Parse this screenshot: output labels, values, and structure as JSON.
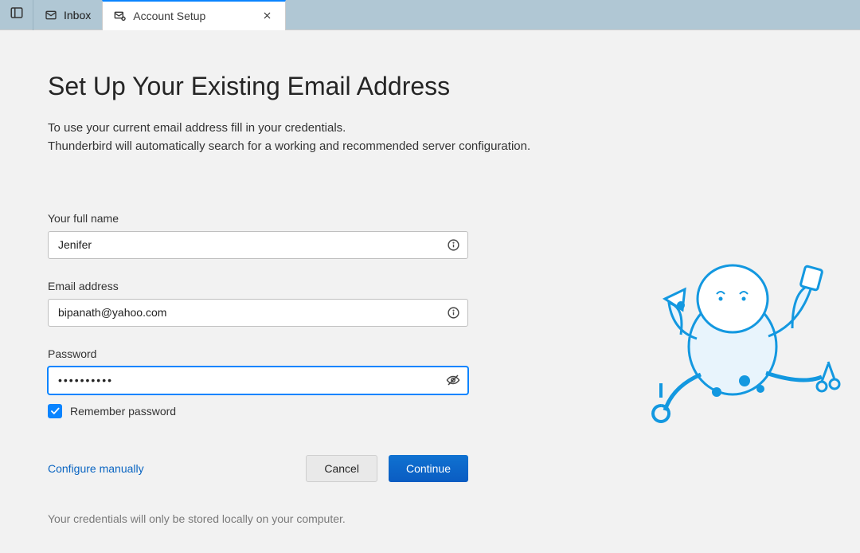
{
  "tabs": {
    "inbox_label": "Inbox",
    "account_setup_label": "Account Setup"
  },
  "page": {
    "title": "Set Up Your Existing Email Address",
    "subtitle_line1": "To use your current email address fill in your credentials.",
    "subtitle_line2": "Thunderbird will automatically search for a working and recommended server configuration."
  },
  "form": {
    "name_label": "Your full name",
    "name_value": "Jenifer",
    "email_label": "Email address",
    "email_value": "bipanath@yahoo.com",
    "password_label": "Password",
    "password_value": "••••••••••",
    "remember_label": "Remember password",
    "remember_checked": true
  },
  "actions": {
    "configure_manually": "Configure manually",
    "cancel": "Cancel",
    "continue": "Continue"
  },
  "footer": {
    "disclaimer": "Your credentials will only be stored locally on your computer."
  },
  "colors": {
    "accent": "#0a84ff",
    "tabbar_bg": "#b0c7d4",
    "continue_bg": "#0a5cc2"
  }
}
